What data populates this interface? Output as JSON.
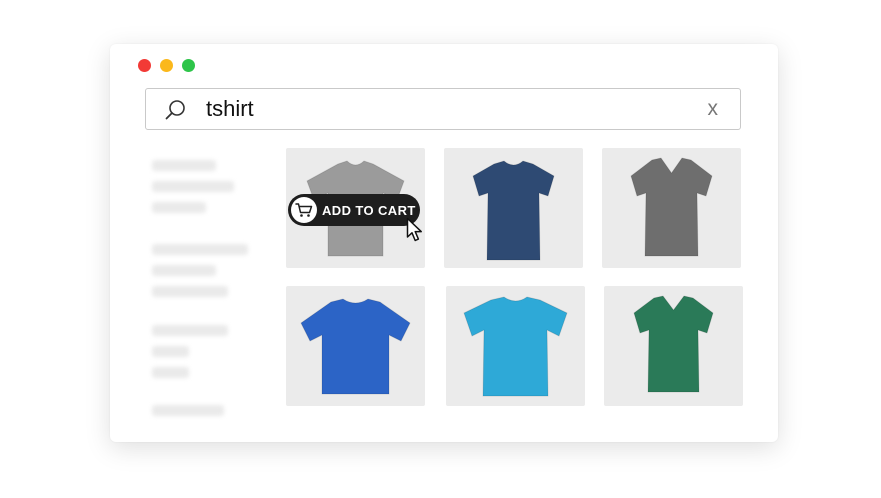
{
  "window": {
    "traffic_lights": {
      "red": "#f23a36",
      "yellow": "#fbb81b",
      "green": "#2ec54a"
    }
  },
  "search": {
    "value": "tshirt",
    "clear_label": "x",
    "icon": "search-icon"
  },
  "products": [
    {
      "color": "#9b9b9b",
      "style": "crew",
      "overlay": "add-to-cart"
    },
    {
      "color": "#2e4a73",
      "style": "crew"
    },
    {
      "color": "#6e6e6e",
      "style": "vneck"
    },
    {
      "color": "#2c64c6",
      "style": "crew"
    },
    {
      "color": "#2ea9d7",
      "style": "crew"
    },
    {
      "color": "#2a7a58",
      "style": "vneck"
    }
  ],
  "add_to_cart": {
    "label": "ADD TO CART",
    "icon": "cart-icon",
    "cursor_icon": "pointer-cursor-icon"
  }
}
